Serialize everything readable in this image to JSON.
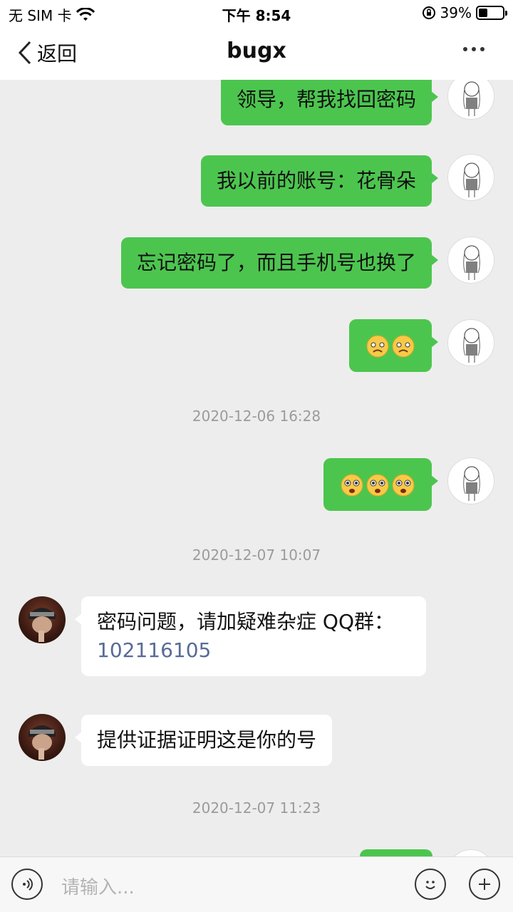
{
  "status_bar": {
    "carrier": "无 SIM 卡",
    "time": "下午 8:54",
    "battery_percent": "39%",
    "battery_level": 0.39
  },
  "nav": {
    "back_label": "返回",
    "title": "bugx"
  },
  "messages": [
    {
      "from": "me",
      "text": "领导，帮我找回密码"
    },
    {
      "from": "me",
      "text": "我以前的账号：花骨朵"
    },
    {
      "from": "me",
      "text": "忘记密码了，而且手机号也换了"
    },
    {
      "from": "me",
      "emoji": [
        "worried-face",
        "worried-face"
      ]
    },
    {
      "from": "me",
      "emoji": [
        "pleading-face",
        "pleading-face",
        "pleading-face"
      ]
    },
    {
      "from": "other",
      "text": "密码问题，请加疑难杂症 QQ群：",
      "link": "102116105"
    },
    {
      "from": "other",
      "text": "提供证据证明这是你的号"
    }
  ],
  "timestamps": [
    "2020-12-06 16:28",
    "2020-12-07 10:07",
    "2020-12-07 11:23"
  ],
  "input": {
    "placeholder": "请输入..."
  },
  "colors": {
    "my_bubble": "#4cc54f",
    "other_bubble": "#ffffff",
    "background": "#ededed",
    "link": "#576b95"
  }
}
